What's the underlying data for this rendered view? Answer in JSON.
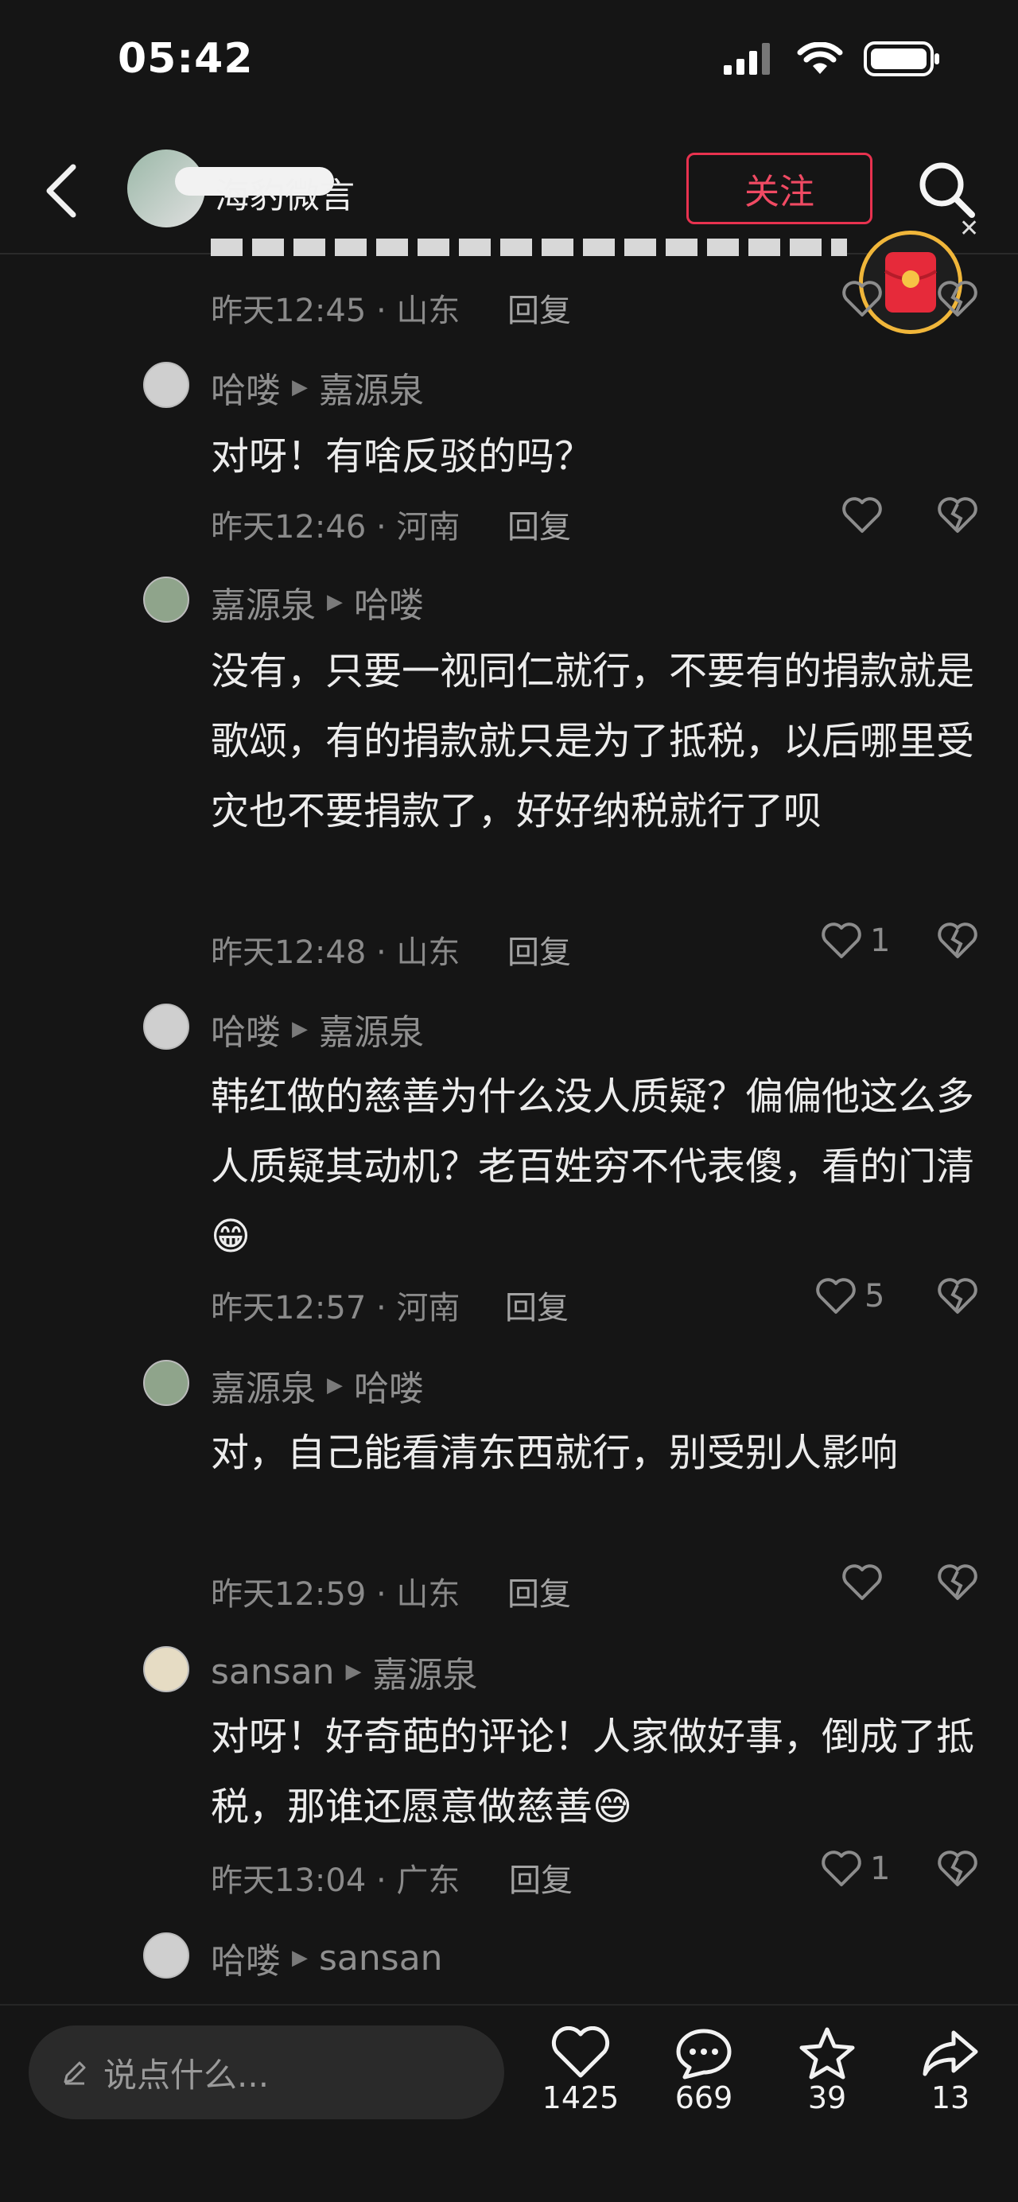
{
  "status_bar": {
    "time": "05:42"
  },
  "header": {
    "author": "海豹微言",
    "follow_label": "关注"
  },
  "comments": [
    {
      "meta": "昨天12:45 · 山东",
      "reply": "回复",
      "likes": ""
    },
    {
      "user": "哈喽",
      "target": "嘉源泉",
      "text": "对呀！有啥反驳的吗？",
      "meta": "昨天12:46 · 河南",
      "reply": "回复",
      "likes": ""
    },
    {
      "user": "嘉源泉",
      "target": "哈喽",
      "text": "没有，只要一视同仁就行，不要有的捐款就是歌颂，有的捐款就只是为了抵税，以后哪里受灾也不要捐款了，好好纳税就行了呗",
      "meta": "昨天12:48 · 山东",
      "reply": "回复",
      "likes": "1"
    },
    {
      "user": "哈喽",
      "target": "嘉源泉",
      "text": "韩红做的慈善为什么没人质疑？偏偏他这么多人质疑其动机？老百姓穷不代表傻，看的门清😁",
      "meta": "昨天12:57 · 河南",
      "reply": "回复",
      "likes": "5"
    },
    {
      "user": "嘉源泉",
      "target": "哈喽",
      "text": "对，自己能看清东西就行，别受别人影响",
      "meta": "昨天12:59 · 山东",
      "reply": "回复",
      "likes": ""
    },
    {
      "user": "sansan",
      "target": "嘉源泉",
      "text": "对呀！好奇葩的评论！人家做好事，倒成了抵税，那谁还愿意做慈善😅",
      "meta": "昨天13:04 · 广东",
      "reply": "回复",
      "likes": "1"
    },
    {
      "user": "哈喽",
      "target": "sansan"
    }
  ],
  "bottom_bar": {
    "input_placeholder": "说点什么...",
    "like_count": "1425",
    "comment_count": "669",
    "favorite_count": "39",
    "share_count": "13"
  },
  "colors": {
    "accent": "#e8324f",
    "background": "#151515",
    "gold": "#f0b63a"
  }
}
